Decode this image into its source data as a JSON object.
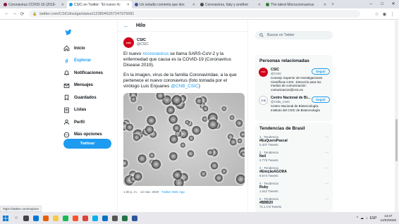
{
  "browser": {
    "tabs": [
      {
        "title": "Coronavirus COVID-19 (2019-",
        "color": "#8a1538",
        "active": false
      },
      {
        "title": "CSIC en Twitter: \"El nuevo #c",
        "color": "#1d9bf0",
        "active": true
      },
      {
        "title": "Un estudio comenta que dos",
        "color": "#3b5998",
        "active": false
      },
      {
        "title": "Coronavirus, Italy y another",
        "color": "#4a4a4a",
        "active": false
      },
      {
        "title": "The latest Microcoronavirus",
        "color": "#2e7d32",
        "active": false
      }
    ],
    "new_tab": "+",
    "window_controls": [
      "–",
      "□",
      "✕"
    ],
    "url": "twitter.com/CSICdivulga/status/1238045267247975681",
    "nav": {
      "back": "←",
      "forward": "→",
      "reload": "⟳"
    }
  },
  "twitter": {
    "nav_items": [
      {
        "label": "Inicio",
        "icon": "home-icon",
        "active": false
      },
      {
        "label": "Explorar",
        "icon": "hashtag-icon",
        "active": true
      },
      {
        "label": "Notificaciones",
        "icon": "bell-icon",
        "active": false
      },
      {
        "label": "Mensajes",
        "icon": "envelope-icon",
        "active": false
      },
      {
        "label": "Guardados",
        "icon": "bookmark-icon",
        "active": false
      },
      {
        "label": "Listas",
        "icon": "list-icon",
        "active": false
      },
      {
        "label": "Perfil",
        "icon": "user-icon",
        "active": false
      },
      {
        "label": "Más opciones",
        "icon": "more-icon",
        "active": false
      }
    ],
    "tweet_button": "Twittear",
    "header_title": "Hilo",
    "tweet": {
      "author_name": "CSIC",
      "author_handle": "@CSIC",
      "avatar_text": "csic",
      "paragraph1_pre": "El nuevo ",
      "paragraph1_tag": "#coronavirus",
      "paragraph1_post": " se llama SARS-CoV-2 y la enfermedad que causa es la COVID-19 (Coronavirus Disease 2019).",
      "paragraph2_pre": "En la imagen, virus de la familia Coronaviridae, a la que pertenece el nuevo coronavirus (foto tomada por el virólogo Luis Enjuanes ",
      "paragraph2_tag": "@CNB_CSIC",
      "paragraph2_post": ")",
      "meta_time": "1:35 p. m. · 12 mar. 2020 · ",
      "meta_source": "Twitter Web App"
    },
    "search_placeholder": "Buscar en Twitter",
    "related_title": "Personas relacionadas",
    "related": [
      {
        "name": "CSIC",
        "handle": "@CSIC",
        "avatar_text": "csic",
        "bio": "Consejo Superior de Investigaciones Científicas CSIC. Dirección para los medios de comunicación: comunicacion@csic.es",
        "follow": "Seguir"
      },
      {
        "name": "Centro Nacional de Bi...",
        "handle": "@CNB_CSIC",
        "avatar_text": "CNB",
        "bio": "Centro Nacional de Biotecnología, Instituto del CSIC de Biotecnología",
        "follow": "Seguir"
      }
    ],
    "trends_title": "Tendencias de Brasil",
    "trends": [
      {
        "ctx": "1 · Tendencia",
        "topic": "#EuQueroPascal",
        "count": "5.407 Tweets"
      },
      {
        "ctx": "2 · Tendencia",
        "topic": "Neil",
        "count": "2.776 Tweets"
      },
      {
        "ctx": "3 · Tendencia",
        "topic": "#EleiçãoAGORA",
        "count": "9.574 Tweets"
      },
      {
        "ctx": "4 · Tendencia",
        "topic": "Ruby",
        "count": "1.612 Tweets"
      },
      {
        "ctx": "5 · Tendencia",
        "topic": "#BBB20",
        "count": "71.1 mil Tweets"
      }
    ]
  },
  "status_text": "https://twitter.com/explore",
  "taskbar": {
    "apps": [
      {
        "name": "task-view-icon",
        "color": "#444444"
      },
      {
        "name": "edge-icon",
        "color": "#0078d7"
      },
      {
        "name": "firefox-icon",
        "color": "#e66000"
      },
      {
        "name": "file-explorer-icon",
        "color": "#f7c948"
      },
      {
        "name": "spotify-icon",
        "color": "#1db954"
      },
      {
        "name": "brave-icon",
        "color": "#fb542b"
      },
      {
        "name": "chrome-icon",
        "color": "#db4437"
      },
      {
        "name": "skype-icon",
        "color": "#00aff0"
      },
      {
        "name": "mail-icon",
        "color": "#0072c6"
      },
      {
        "name": "settings-icon",
        "color": "#555555"
      },
      {
        "name": "excel-icon",
        "color": "#217346"
      },
      {
        "name": "word-icon",
        "color": "#2b579a"
      }
    ],
    "tray_icons": [
      "^",
      "☁",
      "♪",
      "ESP"
    ],
    "time": "13:47",
    "date": "12/03/2020"
  }
}
